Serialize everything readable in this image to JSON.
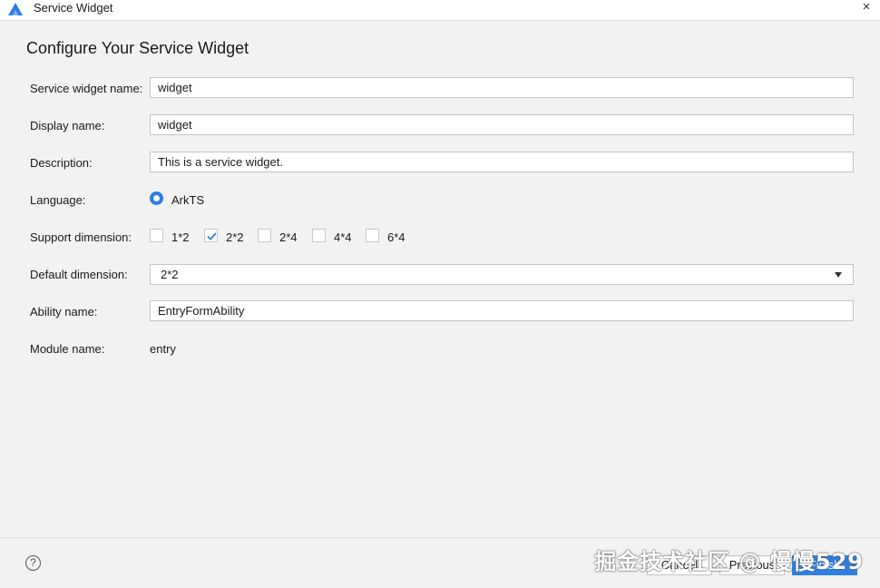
{
  "window": {
    "title": "Service Widget",
    "close_glyph": "×"
  },
  "header": {
    "title": "Configure Your Service Widget"
  },
  "form": {
    "service_widget_name": {
      "label": "Service widget name:",
      "value": "widget"
    },
    "display_name": {
      "label": "Display name:",
      "value": "widget"
    },
    "description": {
      "label": "Description:",
      "value": "This is a service widget."
    },
    "language": {
      "label": "Language:",
      "option": "ArkTS",
      "selected": true
    },
    "support_dimension": {
      "label": "Support dimension:",
      "options": [
        {
          "label": "1*2",
          "checked": false
        },
        {
          "label": "2*2",
          "checked": true
        },
        {
          "label": "2*4",
          "checked": false
        },
        {
          "label": "4*4",
          "checked": false
        },
        {
          "label": "6*4",
          "checked": false
        }
      ]
    },
    "default_dimension": {
      "label": "Default dimension:",
      "value": "2*2"
    },
    "ability_name": {
      "label": "Ability name:",
      "value": "EntryFormAbility"
    },
    "module_name": {
      "label": "Module name:",
      "value": "entry"
    }
  },
  "footer": {
    "help_glyph": "?",
    "cancel_label": "Cancel",
    "previous_label": "Previous",
    "finish_label": "Finish"
  },
  "watermark": {
    "text": "掘金技术社区 @ 慢慢529"
  },
  "colors": {
    "accent": "#2b7de9",
    "background": "#f2f2f2"
  }
}
